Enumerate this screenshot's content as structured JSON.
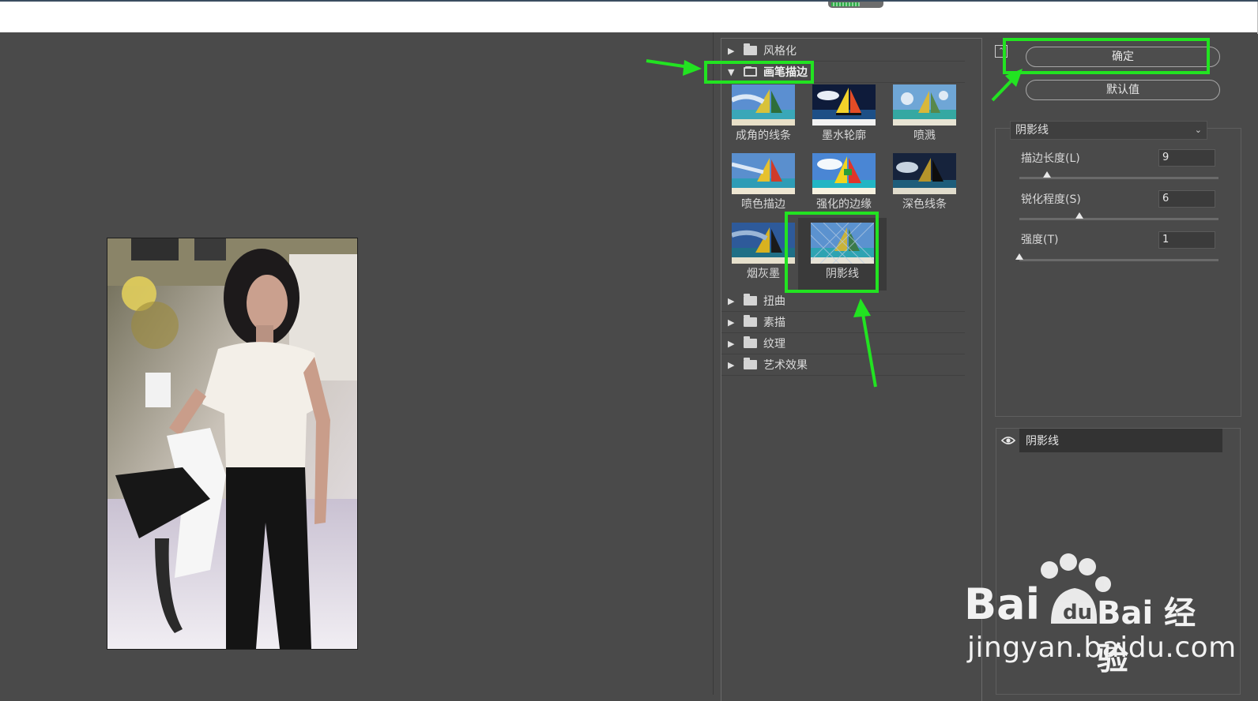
{
  "filter_gallery": {
    "categories": [
      {
        "label": "风格化",
        "expanded": false
      },
      {
        "label": "画笔描边",
        "expanded": true
      },
      {
        "label": "扭曲",
        "expanded": false
      },
      {
        "label": "素描",
        "expanded": false
      },
      {
        "label": "纹理",
        "expanded": false
      },
      {
        "label": "艺术效果",
        "expanded": false
      }
    ],
    "brush_stroke_filters": [
      {
        "label": "成角的线条",
        "selected": false
      },
      {
        "label": "墨水轮廓",
        "selected": false
      },
      {
        "label": "喷溅",
        "selected": false
      },
      {
        "label": "喷色描边",
        "selected": false
      },
      {
        "label": "强化的边缘",
        "selected": false
      },
      {
        "label": "深色线条",
        "selected": false
      },
      {
        "label": "烟灰墨",
        "selected": false
      },
      {
        "label": "阴影线",
        "selected": true
      }
    ]
  },
  "actions": {
    "ok_label": "确定",
    "default_label": "默认值"
  },
  "settings": {
    "selected_filter": "阴影线",
    "params": [
      {
        "label": "描边长度(L)",
        "value": "9",
        "slider_fraction": 0.14
      },
      {
        "label": "锐化程度(S)",
        "value": "6",
        "slider_fraction": 0.3
      },
      {
        "label": "强度(T)",
        "value": "1",
        "slider_fraction": 0.0
      }
    ]
  },
  "effect_layers": [
    {
      "label": "阴影线",
      "visible": true
    }
  ],
  "watermark": {
    "brand": "Bai  经验",
    "url": "jingyan.baidu.com"
  },
  "colors": {
    "highlight": "#22e321",
    "panel_bg": "#4a4a4a"
  }
}
